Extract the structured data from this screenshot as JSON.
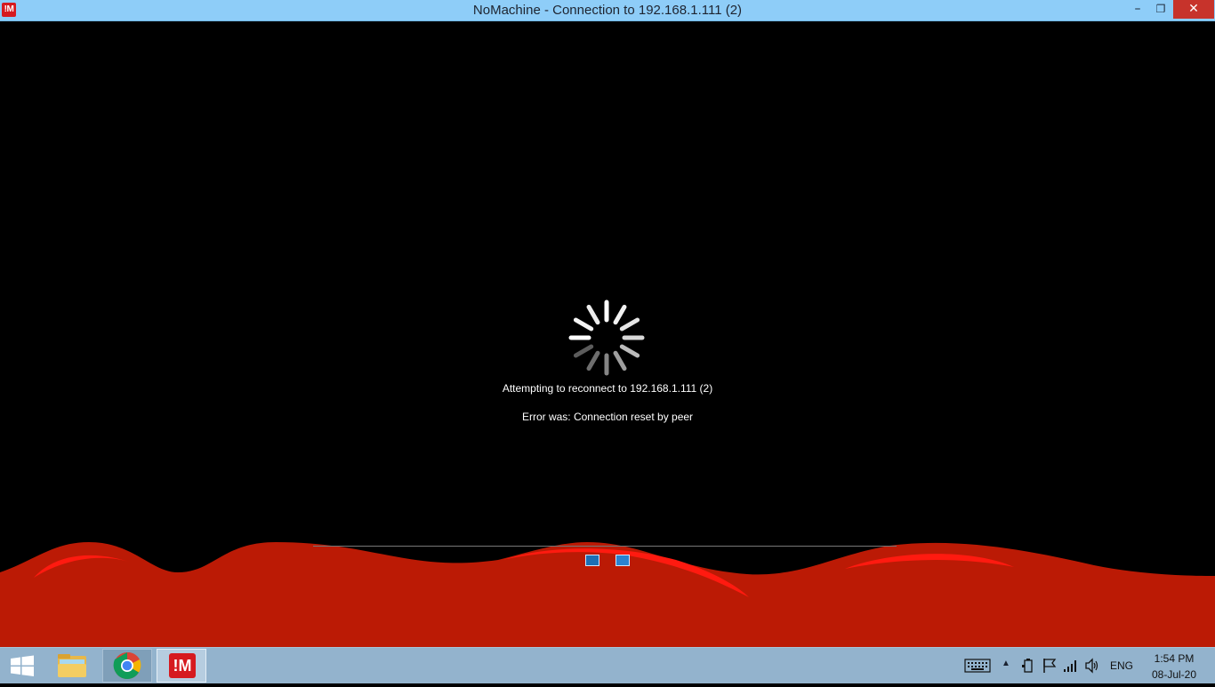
{
  "window": {
    "title": "NoMachine - Connection to 192.168.1.111 (2)",
    "app_icon_text": "!M",
    "minimize_glyph": "–",
    "restore_glyph": "❐",
    "close_glyph": "✕"
  },
  "session": {
    "status_text": "Attempting to reconnect to 192.168.1.111 (2)",
    "error_text": "Error was:  Connection reset by peer",
    "toolbar_icons": [
      "fullscreen-icon",
      "fit-display-icon"
    ]
  },
  "colors": {
    "title_bar": "#8ecdf8",
    "wave_dark": "#bb1a05",
    "wave_light": "#ff1a10",
    "taskbar": "#93b3cd",
    "close_button": "#c7332b"
  },
  "taskbar": {
    "pinned": [
      {
        "name": "start",
        "icon": "windows-logo-icon"
      },
      {
        "name": "file-explorer",
        "icon": "folder-icon"
      },
      {
        "name": "chrome",
        "icon": "chrome-icon"
      },
      {
        "name": "nomachine",
        "icon": "nomachine-icon",
        "label": "!M"
      }
    ],
    "tray": {
      "icons": [
        "keyboard-icon",
        "show-hidden-icons-icon",
        "power-icon",
        "action-center-flag-icon",
        "network-signal-icon",
        "volume-icon"
      ],
      "language": "ENG",
      "time": "1:54 PM",
      "date": "08-Jul-20"
    }
  }
}
